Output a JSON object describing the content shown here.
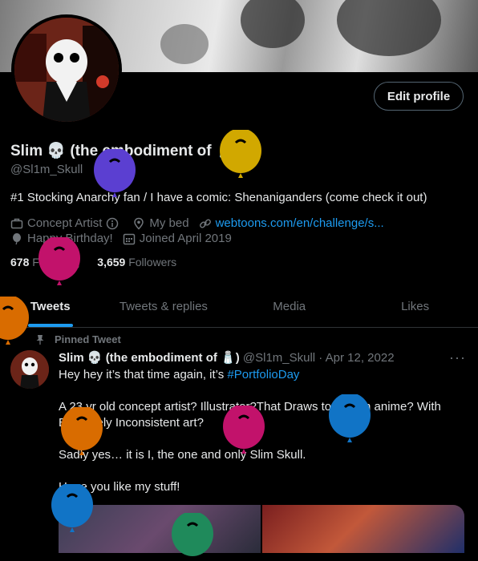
{
  "profile": {
    "name": "Slim 💀 (the embodiment of 🧂)",
    "handle": "@Sl1m_Skull",
    "bio": "#1 Stocking Anarchy fan / I have a comic: Shenaniganders (come check it out)",
    "edit_label": "Edit profile",
    "category": "Concept Artist",
    "location": "My bed",
    "website": "webtoons.com/en/challenge/s...",
    "birthday": "Happy Birthday!",
    "joined": "Joined April 2019",
    "following_count": "678",
    "following_label": "Following",
    "followers_count": "3,659",
    "followers_label": "Followers"
  },
  "tabs": [
    "Tweets",
    "Tweets & replies",
    "Media",
    "Likes"
  ],
  "tweet": {
    "pinned_label": "Pinned Tweet",
    "name": "Slim 💀 (the embodiment of 🧂)",
    "handle_date": "@Sl1m_Skull · Apr 12, 2022",
    "line1_text": "Hey hey it’s that time again, it’s ",
    "line1_tag": "#PortfolioDay",
    "line2": "A 23 yr old concept artist? Illustrator?That Draws too much anime? With",
    "line3": "Extremely Inconsistent art?",
    "line4": "Sadly yes… it is I, the one and only Slim Skull.",
    "line5": "Hope you like my stuff!",
    "more": "···"
  },
  "colors": {
    "accent": "#1d9bf0",
    "balloon_purple": "#5b3fd1",
    "balloon_gold": "#d1a800",
    "balloon_magenta": "#c2126b",
    "balloon_orange": "#d96c00",
    "balloon_blue": "#1174c6",
    "balloon_green": "#1f8a5b"
  }
}
